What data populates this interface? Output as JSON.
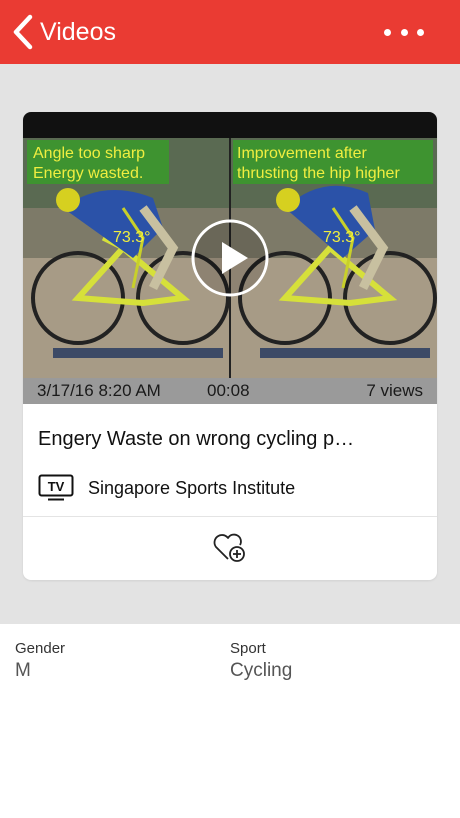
{
  "header": {
    "back_label": "Videos",
    "accent_color": "#ea3b33",
    "back_icon": "chevron-left-icon",
    "more_icon": "more-horizontal-icon"
  },
  "video": {
    "date": "3/17/16 8:20 AM",
    "duration": "00:08",
    "views": "7 views",
    "title": "Engery Waste on wrong cycling p…",
    "source": "Singapore Sports Institute",
    "source_badge": "TV",
    "left_caption_line1": "Angle too sharp",
    "left_caption_line2": "Energy wasted.",
    "right_caption_line1": "Improvement after",
    "right_caption_line2": "thrusting the hip higher",
    "left_angle": "73.3°",
    "right_angle": "73.3°",
    "fav_icon": "heart-plus-icon",
    "play_icon": "play-icon"
  },
  "details": {
    "gender_label": "Gender",
    "gender_value": "M",
    "sport_label": "Sport",
    "sport_value": "Cycling"
  }
}
